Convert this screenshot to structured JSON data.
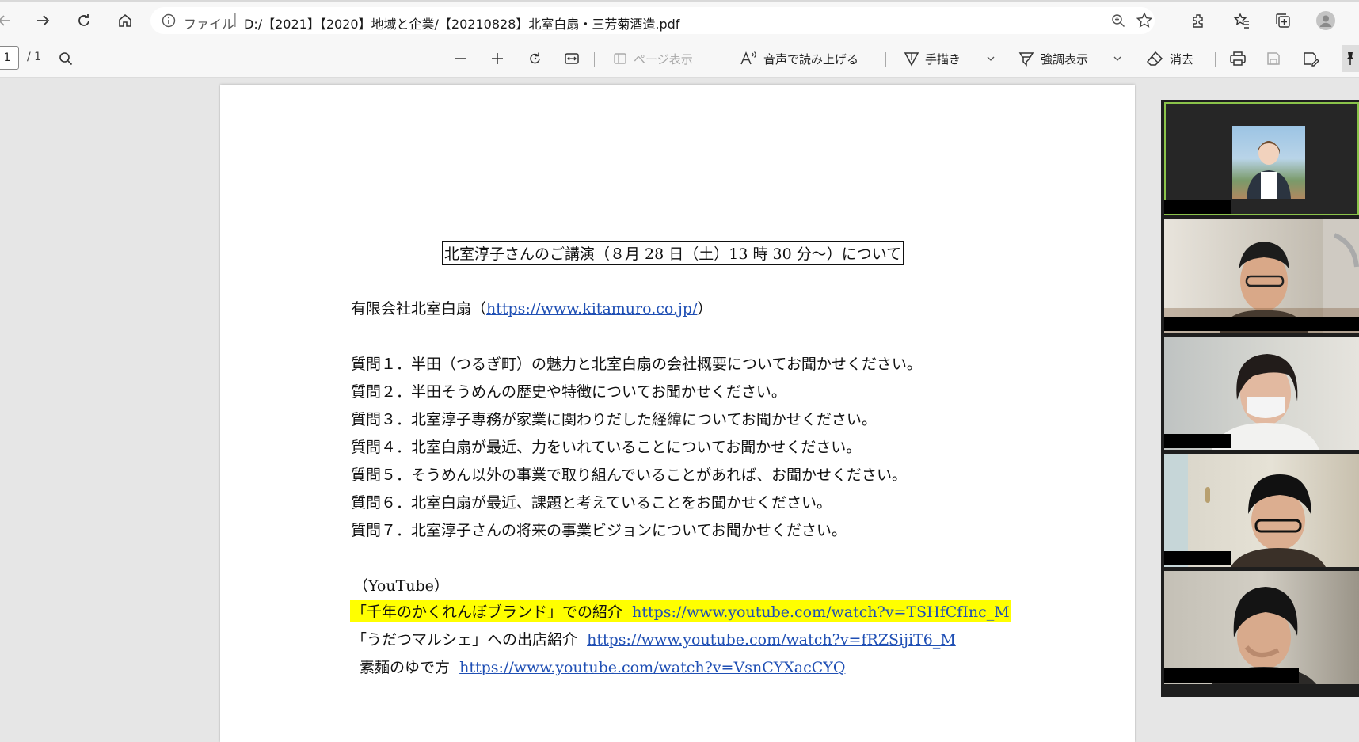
{
  "address_bar": {
    "scheme_label": "ファイル",
    "separator": "|",
    "url": "D:/【2021】【2020】地域と企業/【20210828】北室白扇・三芳菊酒造.pdf"
  },
  "pdf_toolbar": {
    "page_number": "1",
    "page_total": "/ 1",
    "page_view_label": "ページ表示",
    "read_aloud_label": "音声で読み上げる",
    "draw_label": "手描き",
    "highlight_label": "強調表示",
    "erase_label": "消去"
  },
  "document": {
    "title": "北室淳子さんのご講演（８月 28 日（土）13 時 30 分〜）について",
    "company_prefix": "有限会社北室白扇（",
    "company_url": "https://www.kitamuro.co.jp/",
    "company_suffix": "）",
    "questions": [
      "質問１．半田（つるぎ町）の魅力と北室白扇の会社概要についてお聞かせください。",
      "質問２．半田そうめんの歴史や特徴についてお聞かせください。",
      "質問３．北室淳子専務が家業に関わりだした経緯についてお聞かせください。",
      "質問４．北室白扇が最近、力をいれていることについてお聞かせください。",
      "質問５．そうめん以外の事業で取り組んでいることがあれば、お聞かせください。",
      "質問６．北室白扇が最近、課題と考えていることをお聞かせください。",
      "質問７．北室淳子さんの将来の事業ビジョンについてお聞かせください。"
    ],
    "youtube_heading": "（YouTube）",
    "links": [
      {
        "label": "「千年のかくれんぼブランド」での紹介",
        "url": "https://www.youtube.com/watch?v=TSHfCfInc_M"
      },
      {
        "label": "「うだつマルシェ」への出店紹介",
        "url": "https://www.youtube.com/watch?v=fRZSijiT6_M"
      },
      {
        "label": "素麺のゆで方",
        "url": "https://www.youtube.com/watch?v=VsnCYXacCYQ"
      }
    ]
  },
  "colors": {
    "highlight": "#ffff00",
    "link": "#1f4fb4",
    "active_speaker": "#8bc34a"
  }
}
